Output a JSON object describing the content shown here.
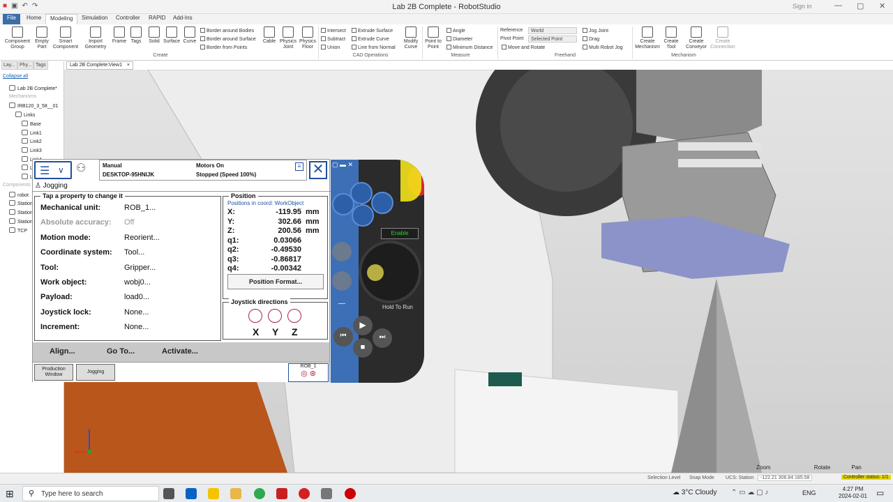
{
  "window": {
    "title": "Lab 2B Complete - RobotStudio",
    "sign_in": "Sign in"
  },
  "menu_tabs": [
    "File",
    "Home",
    "Modeling",
    "Simulation",
    "Controller",
    "RAPID",
    "Add-Ins"
  ],
  "ribbon": {
    "create": {
      "component_group": "Component Group",
      "empty_part": "Empty Part",
      "smart_component": "Smart Component",
      "import_geometry": "Import Geometry",
      "frame": "Frame",
      "tags": "Tags",
      "solid": "Solid",
      "surface": "Surface",
      "curve": "Curve",
      "border_bodies": "Border around Bodies",
      "border_surface": "Border around Surface",
      "border_points": "Border from Points",
      "cable": "Cable",
      "physics_joint": "Physics Joint",
      "physics_floor": "Physics Floor",
      "group_label": "Create"
    },
    "cad": {
      "intersect": "Intersect",
      "subtract": "Subtract",
      "union": "Union",
      "extrude_surface": "Extrude Surface",
      "extrude_curve": "Extrude Curve",
      "line_from_normal": "Line from Normal",
      "modify_curve": "Modify Curve",
      "group_label": "CAD Operations"
    },
    "measure": {
      "point_to_point": "Point to Point",
      "angle": "Angle",
      "diameter": "Diameter",
      "minimum_distance": "Minimum Distance",
      "group_label": "Measure"
    },
    "freehand": {
      "reference_label": "Reference",
      "reference_value": "World",
      "pivot_label": "Pivot Point",
      "pivot_value": "Selected Point",
      "move_rotate": "Move and Rotate",
      "jog_joint": "Jog Joint",
      "drag": "Drag",
      "multi_robot_jog": "Multi Robot Jog",
      "group_label": "Freehand"
    },
    "mechanism": {
      "create_mechanism": "Create Mechanism",
      "create_tool": "Create Tool",
      "create_conveyor": "Create Conveyor",
      "create_connection": "Create Connection",
      "group_label": "Mechanism"
    }
  },
  "left_panel": {
    "tabs": [
      "Lay...",
      "Phy...",
      "Tags"
    ],
    "collapse_all": "Collapse all",
    "tree": [
      {
        "label": "Lab 2B Complete*",
        "grey": false
      },
      {
        "label": "Mechanisms",
        "grey": true
      },
      {
        "label": "IRB120_3_58__01",
        "grey": false
      },
      {
        "label": "Links",
        "grey": false
      },
      {
        "label": "Base",
        "grey": false
      },
      {
        "label": "Link1",
        "grey": false
      },
      {
        "label": "Link2",
        "grey": false
      },
      {
        "label": "Link3",
        "grey": false
      },
      {
        "label": "Link4",
        "grey": false
      },
      {
        "label": "Link5",
        "grey": false
      },
      {
        "label": "Link6",
        "grey": false
      },
      {
        "label": "Components",
        "grey": true
      },
      {
        "label": "robot",
        "grey": false
      },
      {
        "label": "Station",
        "grey": false
      },
      {
        "label": "Station",
        "grey": false
      },
      {
        "label": "Station",
        "grey": false
      },
      {
        "label": "TCP",
        "grey": false
      }
    ]
  },
  "doc_tab": "Lab 2B Complete:View1",
  "pendant": {
    "mode": "Manual",
    "host": "DESKTOP-95HNIJK",
    "motors": "Motors On",
    "state": "Stopped (Speed 100%)",
    "screen_title": "Jogging",
    "tap_hint": "Tap a property to change it",
    "properties": [
      {
        "label": "Mechanical unit:",
        "value": "ROB_1...",
        "disabled": false
      },
      {
        "label": "Absolute accuracy:",
        "value": "Off",
        "disabled": true
      },
      {
        "label": "Motion mode:",
        "value": "Reorient...",
        "disabled": false
      },
      {
        "label": "Coordinate system:",
        "value": "Tool...",
        "disabled": false
      },
      {
        "label": "Tool:",
        "value": "Gripper...",
        "disabled": false
      },
      {
        "label": "Work object:",
        "value": "wobj0...",
        "disabled": false
      },
      {
        "label": "Payload:",
        "value": "load0...",
        "disabled": false
      },
      {
        "label": "Joystick lock:",
        "value": "None...",
        "disabled": false
      },
      {
        "label": "Increment:",
        "value": "None...",
        "disabled": false
      }
    ],
    "position": {
      "title": "Position",
      "coord_note": "Positions in coord: WorkObject",
      "rows": [
        {
          "label": "X:",
          "value": "-119.95",
          "unit": "mm"
        },
        {
          "label": "Y:",
          "value": "302.66",
          "unit": "mm"
        },
        {
          "label": "Z:",
          "value": "200.56",
          "unit": "mm"
        },
        {
          "label": "q1:",
          "value": "0.03066",
          "unit": ""
        },
        {
          "label": "q2:",
          "value": "-0.49530",
          "unit": ""
        },
        {
          "label": "q3:",
          "value": "-0.86817",
          "unit": ""
        },
        {
          "label": "q4:",
          "value": "-0.00342",
          "unit": ""
        }
      ],
      "format_button": "Position Format..."
    },
    "joystick": {
      "title": "Joystick directions",
      "axes": [
        "X",
        "Y",
        "Z"
      ]
    },
    "actions": [
      "Align...",
      "Go To...",
      "Activate..."
    ],
    "taskbar": {
      "production_window": "Production Window",
      "jogging": "Jogging",
      "rob": "ROB_1"
    }
  },
  "joypanel": {
    "enable": "Enable",
    "hold_to_run": "Hold To Run"
  },
  "viewport_hints": {
    "zoom": "Zoom",
    "rotate": "Rotate",
    "pan": "Pan"
  },
  "status_bar": {
    "selection_level": "Selection Level",
    "snap_mode": "Snap Mode",
    "ucs": "UCS: Station",
    "coords": "-122.21  306.84  185.58",
    "controller_status": "Controller status: 1/1"
  },
  "taskbar": {
    "search_placeholder": "Type here to search",
    "weather": "3°C  Cloudy",
    "lang": "ENG",
    "time": "4:27 PM",
    "date": "2024-02-01"
  },
  "colors": {
    "accent": "#3b6ea8",
    "pendant_blue": "#1f4f9f",
    "floor": "#b8561c",
    "enable_yellow": "#f2e21a",
    "stop_red": "#d62b2b",
    "controller_status": "#e6d600"
  }
}
